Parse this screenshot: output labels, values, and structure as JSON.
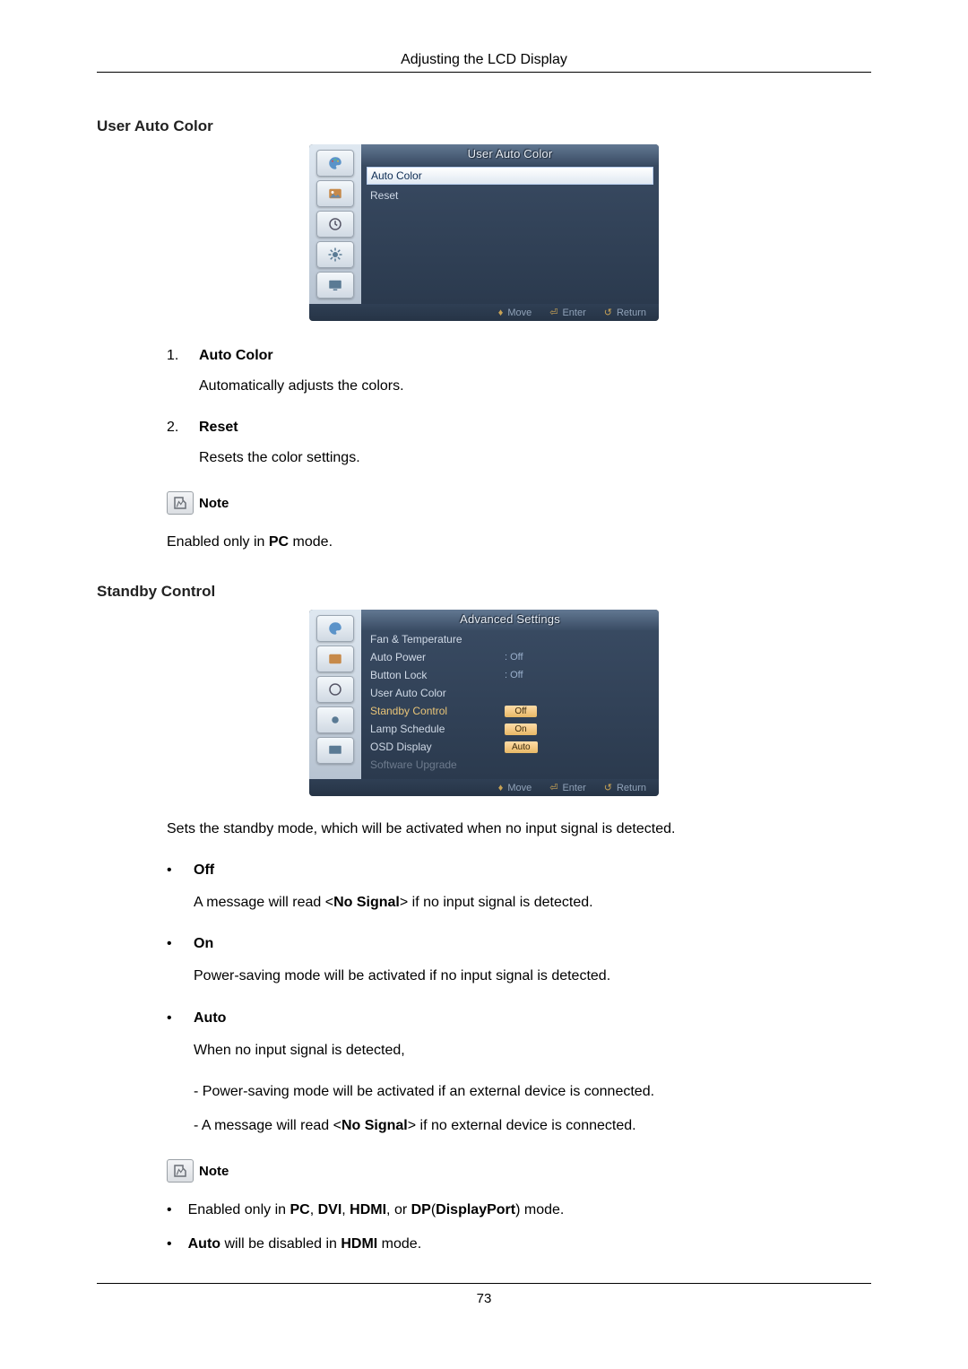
{
  "header": {
    "title": "Adjusting the LCD Display"
  },
  "page_number": "73",
  "section1": {
    "title": "User Auto Color",
    "osd": {
      "title": "User Auto Color",
      "rows": [
        {
          "label": "Auto Color",
          "selected": true
        },
        {
          "label": "Reset",
          "selected": false
        }
      ],
      "hints": {
        "move": "Move",
        "enter": "Enter",
        "return": "Return"
      }
    },
    "items": [
      {
        "num": "1.",
        "title": "Auto Color",
        "body": "Automatically adjusts the colors."
      },
      {
        "num": "2.",
        "title": "Reset",
        "body": "Resets the color settings."
      }
    ],
    "note_label": "Note",
    "note_prefix": "Enabled only in ",
    "note_strong": "PC",
    "note_suffix": " mode."
  },
  "section2": {
    "title": "Standby Control",
    "osd": {
      "title": "Advanced Settings",
      "rows": [
        {
          "label": "Fan & Temperature"
        },
        {
          "label": "Auto Power",
          "value": ": Off"
        },
        {
          "label": "Button Lock",
          "value": ": Off"
        },
        {
          "label": "User Auto Color"
        },
        {
          "label": "Standby Control",
          "box": "Off",
          "highlight": true
        },
        {
          "label": "Lamp Schedule",
          "box": "On"
        },
        {
          "label": "OSD Display",
          "box": "Auto"
        },
        {
          "label": "Software Upgrade",
          "dim": true
        }
      ],
      "hints": {
        "move": "Move",
        "enter": "Enter",
        "return": "Return"
      }
    },
    "intro": "Sets the standby mode, which will be activated when no input signal is detected.",
    "bullets": [
      {
        "title": "Off",
        "body_pre": "A message will read <",
        "body_strong": "No Signal",
        "body_post": "> if no input signal is detected."
      },
      {
        "title": "On",
        "body_plain": "Power-saving mode will be activated if no input signal is detected."
      },
      {
        "title": "Auto",
        "body_plain": "When no input signal is detected,",
        "sub1": "- Power-saving mode will be activated if an external device is connected.",
        "sub2_pre": "- A message will read <",
        "sub2_strong": "No Signal",
        "sub2_post": "> if no external device is connected."
      }
    ],
    "note_label": "Note",
    "note_items": [
      {
        "pre": "Enabled only in ",
        "s1": "PC",
        "c1": ", ",
        "s2": "DVI",
        "c2": ", ",
        "s3": "HDMI",
        "c3": ", or ",
        "s4": "DP",
        "paren": "(",
        "s5": "DisplayPort",
        "post": ") mode."
      },
      {
        "s1": "Auto",
        "mid": " will be disabled in ",
        "s2": "HDMI",
        "post": " mode."
      }
    ]
  }
}
